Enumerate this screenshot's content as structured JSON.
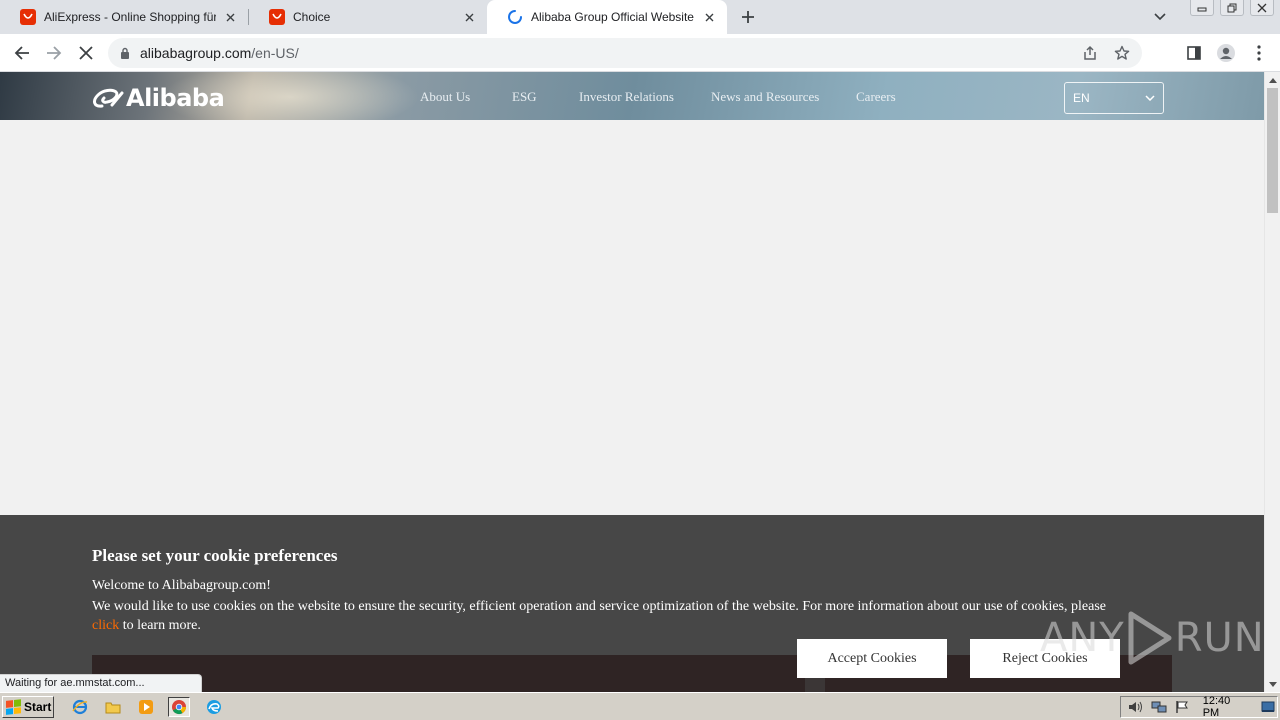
{
  "browser": {
    "tabs": [
      {
        "title": "AliExpress - Online Shopping für Elektronik",
        "favicon": "aliexpress-icon",
        "active": false
      },
      {
        "title": "Choice",
        "favicon": "aliexpress-icon",
        "active": false
      },
      {
        "title": "Alibaba Group Official Website",
        "favicon": "loading-spinner-icon",
        "active": true
      }
    ],
    "address": {
      "host": "alibabagroup.com",
      "path": "/en-US/"
    },
    "status_text": "Waiting for ae.mmstat.com..."
  },
  "site": {
    "logo_text": "Alibaba",
    "nav": [
      "About Us",
      "ESG",
      "Investor Relations",
      "News and Resources",
      "Careers"
    ],
    "language": "EN"
  },
  "cookie_banner": {
    "title": "Please set your cookie preferences",
    "line1": "Welcome to Alibabagroup.com!",
    "line2": "We would like to use cookies on the website to ensure the security, efficient operation and service optimization of the website. For more information about our use of cookies, please",
    "link_text": "click",
    "line3_rest": " to learn more.",
    "accept_label": "Accept Cookies",
    "reject_label": "Reject Cookies"
  },
  "watermark": {
    "text": "ANY RUN"
  },
  "taskbar": {
    "start_label": "Start",
    "clock": "12:40 PM"
  },
  "colors": {
    "accent_orange": "#ff6a00",
    "banner_bg": "#474747",
    "aliexpress_red": "#e62e04"
  }
}
